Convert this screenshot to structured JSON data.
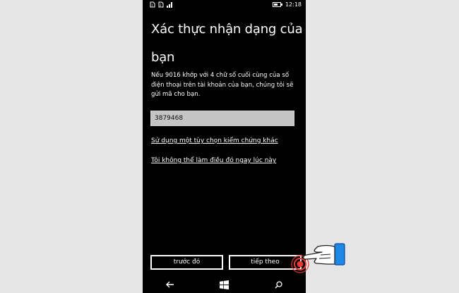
{
  "status_bar": {
    "time": "12:18",
    "icons": [
      "sim1-icon",
      "sim2-icon",
      "signal-icon"
    ],
    "battery_level": 0.6
  },
  "screen": {
    "title": "Xác thực nhận dạng của bạn",
    "description": "Nếu 9016 khớp với 4 chữ số cuối cùng của số điện thoại trên tài khoản của bạn, chúng tôi sẽ gửi mã cho bạn.",
    "input": {
      "value": "3879468",
      "placeholder": ""
    },
    "links": [
      "Sử dụng một tùy chọn kiểm chứng khác",
      "Tôi không thể làm điều đó ngay lúc này"
    ],
    "buttons": {
      "prev": "trước đó",
      "next": "tiếp theo"
    }
  },
  "nav": {
    "back": "back-icon",
    "start": "windows-icon",
    "search": "search-icon"
  },
  "colors": {
    "background": "#000000",
    "text": "#ffffff",
    "input_bg": "#c4c4c4",
    "tap_indicator": "#e53935",
    "hand_cuff": "#1e88e5"
  }
}
